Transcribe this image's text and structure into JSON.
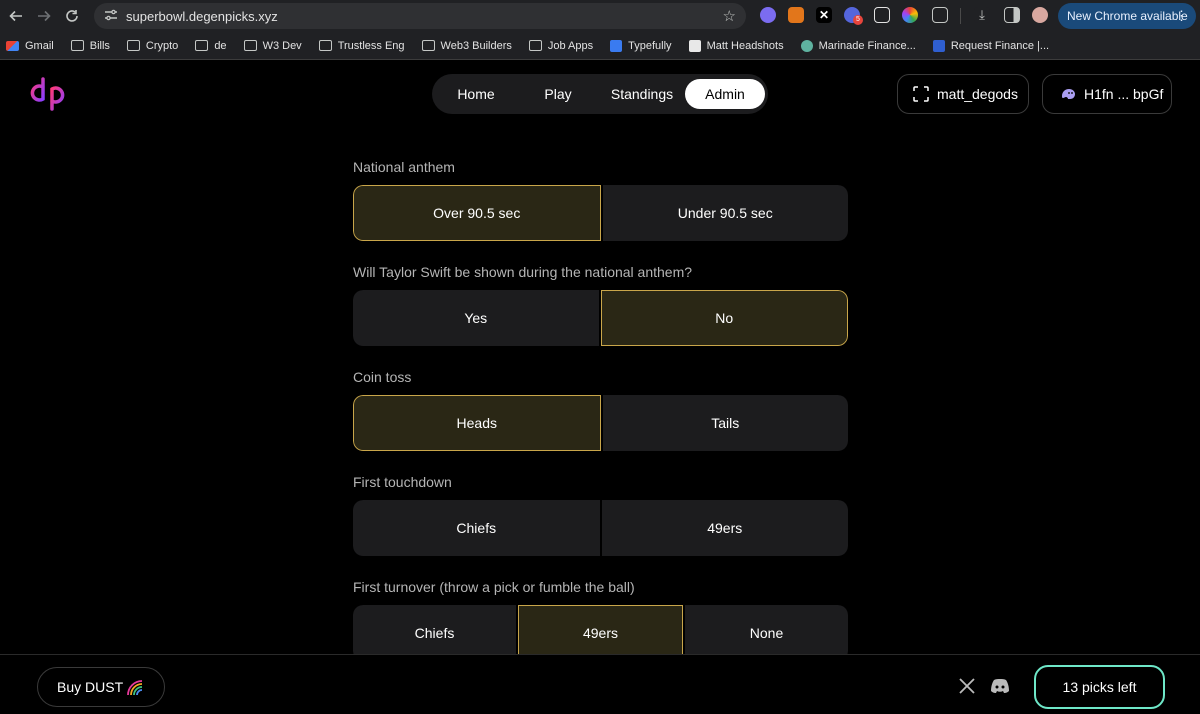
{
  "browser": {
    "url": "superbowl.degenpicks.xyz",
    "new_chrome_label": "New Chrome available",
    "ext_badge": "5"
  },
  "bookmarks": [
    {
      "label": "Gmail",
      "icon": "gmail-icon"
    },
    {
      "label": "Bills",
      "icon": "folder-icon"
    },
    {
      "label": "Crypto",
      "icon": "folder-icon"
    },
    {
      "label": "de",
      "icon": "folder-icon"
    },
    {
      "label": "W3 Dev",
      "icon": "folder-icon"
    },
    {
      "label": "Trustless Eng",
      "icon": "folder-icon"
    },
    {
      "label": "Web3 Builders",
      "icon": "folder-icon"
    },
    {
      "label": "Job Apps",
      "icon": "folder-icon"
    },
    {
      "label": "Typefully",
      "icon": "typefully-icon"
    },
    {
      "label": "Matt Headshots",
      "icon": "page-icon"
    },
    {
      "label": "Marinade Finance...",
      "icon": "marinade-icon"
    },
    {
      "label": "Request Finance |...",
      "icon": "request-icon"
    }
  ],
  "nav": {
    "items": [
      "Home",
      "Play",
      "Standings",
      "Admin"
    ],
    "active": "Admin"
  },
  "user": {
    "username": "matt_degods",
    "wallet": "H1fn ... bpGf"
  },
  "questions": [
    {
      "label": "National anthem",
      "options": [
        "Over 90.5 sec",
        "Under 90.5 sec"
      ],
      "selected": 0
    },
    {
      "label": "Will Taylor Swift be shown during the national anthem?",
      "options": [
        "Yes",
        "No"
      ],
      "selected": 1
    },
    {
      "label": "Coin toss",
      "options": [
        "Heads",
        "Tails"
      ],
      "selected": 0
    },
    {
      "label": "First touchdown",
      "options": [
        "Chiefs",
        "49ers"
      ],
      "selected": -1
    },
    {
      "label": "First turnover (throw a pick or fumble the ball)",
      "options": [
        "Chiefs",
        "49ers",
        "None"
      ],
      "selected": 1
    }
  ],
  "footer": {
    "buy_label": "Buy DUST",
    "picks_left": "13 picks left"
  },
  "colors": {
    "selected_border": "#c9a64a",
    "option_bg": "#1c1c1e",
    "picks_border": "#6ee7c8",
    "logo_pink": "#e6399b",
    "logo_purple": "#8b3dff"
  }
}
